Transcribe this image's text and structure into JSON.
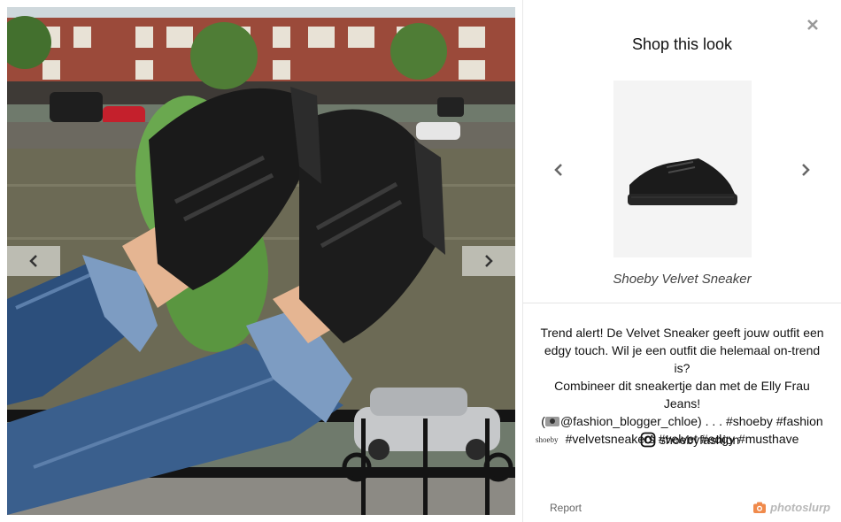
{
  "photo": {
    "prev_label": "previous photo",
    "next_label": "next photo"
  },
  "panel": {
    "title": "Shop this look",
    "product": {
      "name": "Shoeby Velvet Sneaker"
    },
    "caption_lines": [
      "Trend alert! De Velvet Sneaker geeft jouw outfit een",
      "edgy touch. Wil je een outfit die helemaal on-trend is?",
      "Combineer dit sneakertje dan met de Elly Frau Jeans!",
      "@fashion_blogger_chloe) . . . #shoeby #fashion",
      "#velvetsneakers #velvet #edgy #musthave"
    ],
    "caption_open_paren": "(",
    "brand_logo": "shoeby",
    "instagram_handle": "shoebyfashion",
    "report_label": "Report",
    "powered_by": "photoslurp"
  },
  "colors": {
    "accent_orange": "#f08a4b",
    "nav_gray": "#666666"
  },
  "icons": {
    "close": "close-icon",
    "prev": "chevron-left-icon",
    "next": "chevron-right-icon",
    "instagram": "instagram-icon",
    "camera": "camera-icon"
  }
}
